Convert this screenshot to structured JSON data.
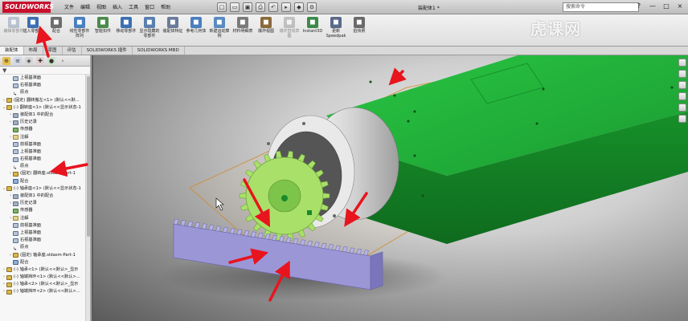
{
  "app": {
    "logo": "SOLIDWORKS",
    "doc_title": "装配体1 *",
    "search_placeholder": "搜索命令",
    "watermark": "虎课网"
  },
  "menu": [
    "文件",
    "编辑",
    "视图",
    "插入",
    "工具",
    "窗口",
    "帮助"
  ],
  "quick_access": [
    "new-icon",
    "open-icon",
    "save-icon",
    "print-icon",
    "undo-icon",
    "select-icon",
    "rebuild-icon",
    "options-icon"
  ],
  "window_controls": [
    "?",
    "—",
    "□",
    "×"
  ],
  "ribbon": [
    {
      "label": "编辑零部件",
      "icon": "edit-component-icon",
      "disabled": true,
      "color": "#7a8fb0"
    },
    {
      "label": "插入零部件",
      "icon": "insert-component-icon",
      "disabled": false,
      "color": "#3c6fb4"
    },
    {
      "label": "配合",
      "icon": "mate-icon",
      "disabled": false,
      "color": "#6d6d6d"
    },
    {
      "label": "线性零部件阵列",
      "icon": "linear-pattern-icon",
      "disabled": false,
      "color": "#4a7fc0"
    },
    {
      "label": "智能扣件",
      "icon": "smart-fastener-icon",
      "disabled": false,
      "color": "#4a8a4a"
    },
    {
      "label": "移动零部件",
      "icon": "move-component-icon",
      "disabled": false,
      "color": "#3c6fb4"
    },
    {
      "label": "显示隐藏的零部件",
      "icon": "show-hidden-icon",
      "disabled": false,
      "color": "#5a7fb0"
    },
    {
      "label": "装配体特征",
      "icon": "assembly-feature-icon",
      "disabled": false,
      "color": "#6a7a9a"
    },
    {
      "label": "参考几何体",
      "icon": "reference-geometry-icon",
      "disabled": false,
      "color": "#4a7fc0"
    },
    {
      "label": "新建运动算例",
      "icon": "new-motion-study-icon",
      "disabled": false,
      "color": "#5a8ac0"
    },
    {
      "label": "材料明细表",
      "icon": "bom-icon",
      "disabled": false,
      "color": "#7a7a7a"
    },
    {
      "label": "爆炸视图",
      "icon": "exploded-view-icon",
      "disabled": false,
      "color": "#8a6a3a"
    },
    {
      "label": "爆炸直线草图",
      "icon": "explode-line-sketch-icon",
      "disabled": true,
      "color": "#8a8a8a"
    },
    {
      "label": "Instant3D",
      "icon": "instant3d-icon",
      "disabled": false,
      "color": "#3c8a4a"
    },
    {
      "label": "更新Speedpak",
      "icon": "speedpak-icon",
      "disabled": false,
      "color": "#5a6a8a"
    },
    {
      "label": "拍快照",
      "icon": "snapshot-icon",
      "disabled": false,
      "color": "#6a6a6a"
    }
  ],
  "tabs": [
    {
      "label": "装配体",
      "active": true
    },
    {
      "label": "布局",
      "active": false
    },
    {
      "label": "草图",
      "active": false
    },
    {
      "label": "评估",
      "active": false
    },
    {
      "label": "SOLIDWORKS 插件",
      "active": false
    },
    {
      "label": "SOLIDWORKS MBD",
      "active": false
    }
  ],
  "tree": [
    {
      "indent": 1,
      "toggle": "",
      "icon": "plane",
      "label": "上视基准面"
    },
    {
      "indent": 1,
      "toggle": "",
      "icon": "plane",
      "label": "右视基准面"
    },
    {
      "indent": 1,
      "toggle": "",
      "icon": "origin",
      "label": "原点"
    },
    {
      "indent": 0,
      "toggle": "›",
      "icon": "part",
      "label": "(固定) 翻转搬左<1> (默认<<默..."
    },
    {
      "indent": 0,
      "toggle": "⌄",
      "icon": "part",
      "label": "(-) 翻转座<1> (默认<<显示状态-1"
    },
    {
      "indent": 1,
      "toggle": "›",
      "icon": "hist",
      "label": "装配体1 中的配合"
    },
    {
      "indent": 1,
      "toggle": "›",
      "icon": "hist",
      "label": "历史记录"
    },
    {
      "indent": 1,
      "toggle": "",
      "icon": "sensor",
      "label": "传感器"
    },
    {
      "indent": 1,
      "toggle": "›",
      "icon": "note",
      "label": "注解"
    },
    {
      "indent": 1,
      "toggle": "",
      "icon": "plane",
      "label": "前视基准面"
    },
    {
      "indent": 1,
      "toggle": "",
      "icon": "plane",
      "label": "上视基准面"
    },
    {
      "indent": 1,
      "toggle": "",
      "icon": "plane",
      "label": "右视基准面"
    },
    {
      "indent": 1,
      "toggle": "",
      "icon": "origin",
      "label": "原点"
    },
    {
      "indent": 1,
      "toggle": "›",
      "icon": "part",
      "label": "(固定) 翻转座.sldasm-Part-1"
    },
    {
      "indent": 1,
      "toggle": "",
      "icon": "mate",
      "label": "配合"
    },
    {
      "indent": 0,
      "toggle": "⌄",
      "icon": "part",
      "label": "(-) 轴承座<1> (默认<<显示状态-1"
    },
    {
      "indent": 1,
      "toggle": "›",
      "icon": "hist",
      "label": "装配体1 中的配合"
    },
    {
      "indent": 1,
      "toggle": "›",
      "icon": "hist",
      "label": "历史记录"
    },
    {
      "indent": 1,
      "toggle": "",
      "icon": "sensor",
      "label": "传感器"
    },
    {
      "indent": 1,
      "toggle": "›",
      "icon": "note",
      "label": "注解"
    },
    {
      "indent": 1,
      "toggle": "",
      "icon": "plane",
      "label": "前视基准面"
    },
    {
      "indent": 1,
      "toggle": "",
      "icon": "plane",
      "label": "上视基准面"
    },
    {
      "indent": 1,
      "toggle": "",
      "icon": "plane",
      "label": "右视基准面"
    },
    {
      "indent": 1,
      "toggle": "",
      "icon": "origin",
      "label": "原点"
    },
    {
      "indent": 1,
      "toggle": "›",
      "icon": "part",
      "label": "(固定) 轴承座.sldasm-Part-1"
    },
    {
      "indent": 1,
      "toggle": "",
      "icon": "mate",
      "label": "配合"
    },
    {
      "indent": 0,
      "toggle": "›",
      "icon": "part",
      "label": "(-) 轴承<1> (默认<<默认>_显示"
    },
    {
      "indent": 0,
      "toggle": "›",
      "icon": "part",
      "label": "(-) 轴端挡环<1> (默认<<默认>..."
    },
    {
      "indent": 0,
      "toggle": "›",
      "icon": "part",
      "label": "(-) 轴承<2> (默认<<默认>_显示"
    },
    {
      "indent": 0,
      "toggle": "›",
      "icon": "part",
      "label": "(-) 轴端挡环<2> (默认<<默认>..."
    }
  ],
  "colors": {
    "arm": "#22b33a",
    "arm_dark": "#178a2a",
    "gear": "#a9e06a",
    "gear_dark": "#6ea53a",
    "rack": "#9b97d6",
    "rack_dark": "#6a66a8",
    "arrow": "#e8141e",
    "sketch": "#d08a2a"
  }
}
